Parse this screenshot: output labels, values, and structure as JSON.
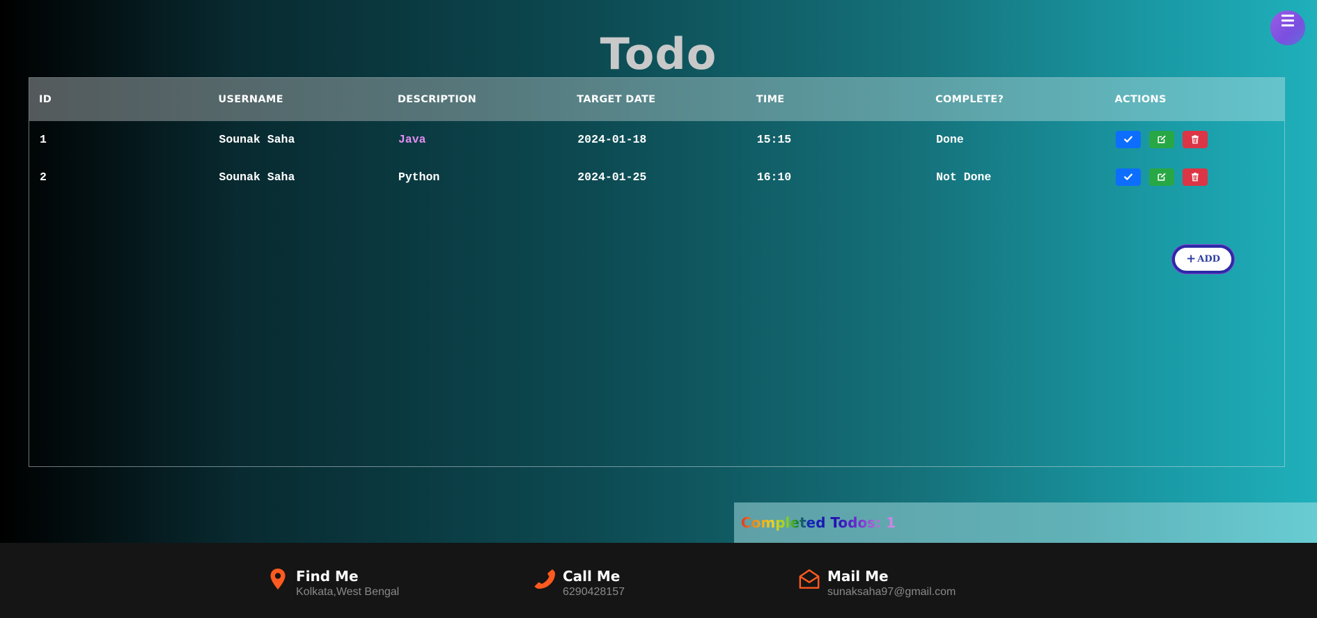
{
  "header": {
    "title": "Todo"
  },
  "table": {
    "columns": [
      "ID",
      "USERNAME",
      "DESCRIPTION",
      "TARGET DATE",
      "TIME",
      "COMPLETE?",
      "ACTIONS"
    ],
    "rows": [
      {
        "id": "1",
        "username": "Sounak Saha",
        "description": "Java",
        "target_date": "2024-01-18",
        "time": "15:15",
        "complete": "Done"
      },
      {
        "id": "2",
        "username": "Sounak Saha",
        "description": "Python",
        "target_date": "2024-01-25",
        "time": "16:10",
        "complete": "Not Done"
      }
    ]
  },
  "add_button": {
    "label": "ADD",
    "icon": "plus-icon"
  },
  "completed": {
    "text": "Completed Todos: 1"
  },
  "footer": {
    "find": {
      "title": "Find Me",
      "value": "Kolkata,West Bengal",
      "icon": "map-marker-icon"
    },
    "call": {
      "title": "Call Me",
      "value": "6290428157",
      "icon": "phone-icon"
    },
    "mail": {
      "title": "Mail Me",
      "value": "sunaksaha97@gmail.com",
      "icon": "envelope-open-icon"
    }
  },
  "colors": {
    "accent_orange": "#ff5a1f",
    "check_blue": "#0d6efd",
    "edit_green": "#28a745",
    "delete_red": "#dc3545",
    "description_highlight": "#e28cf0"
  }
}
